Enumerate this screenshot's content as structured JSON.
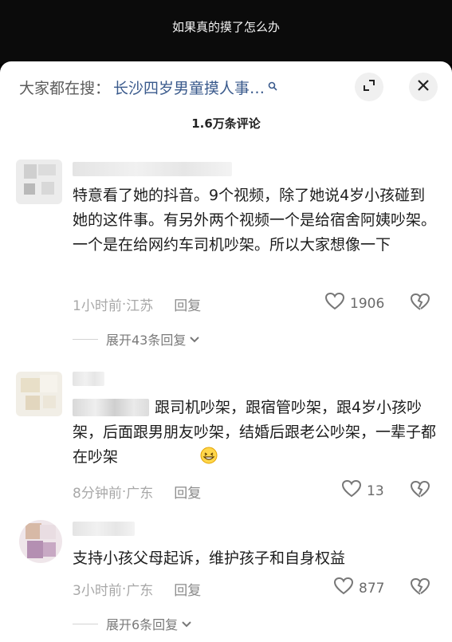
{
  "video": {
    "title": "如果真的摸了怎么办"
  },
  "search": {
    "prefix": "大家都在搜：",
    "term": "长沙四岁男童摸人事…"
  },
  "comments_header": {
    "count": "1.6万条评论"
  },
  "comments": [
    {
      "text": "特意看了她的抖音。9个视频，除了她说4岁小孩碰到她的这件事。有另外两个视频一个是给宿舍阿姨吵架。一个是在给网约车司机吵架。所以大家想像一下",
      "time": "1小时前",
      "location": "江苏",
      "reply_label": "回复",
      "likes": "1906",
      "expand_label": "展开43条回复"
    },
    {
      "text": "跟司机吵架，跟宿管吵架，跟4岁小孩吵架，后面跟男朋友吵架，结婚后跟老公吵架，一辈子都在吵架",
      "time": "8分钟前",
      "location": "广东",
      "reply_label": "回复",
      "likes": "13"
    },
    {
      "text": "支持小孩父母起诉，维护孩子和自身权益",
      "time": "3小时前",
      "location": "广东",
      "reply_label": "回复",
      "likes": "877",
      "expand_label": "展开6条回复"
    }
  ],
  "separator": " · ",
  "icons": {
    "search": "search-icon",
    "expand": "expand-icon",
    "close": "close-icon",
    "like": "heart-icon",
    "dislike": "broken-heart-icon",
    "chevron": "chevron-down-icon",
    "emoji": "grin-emoji-icon"
  },
  "colors": {
    "search_term": "#3a5a8c",
    "text": "#1d1d1d",
    "meta": "#a8a8a8"
  }
}
